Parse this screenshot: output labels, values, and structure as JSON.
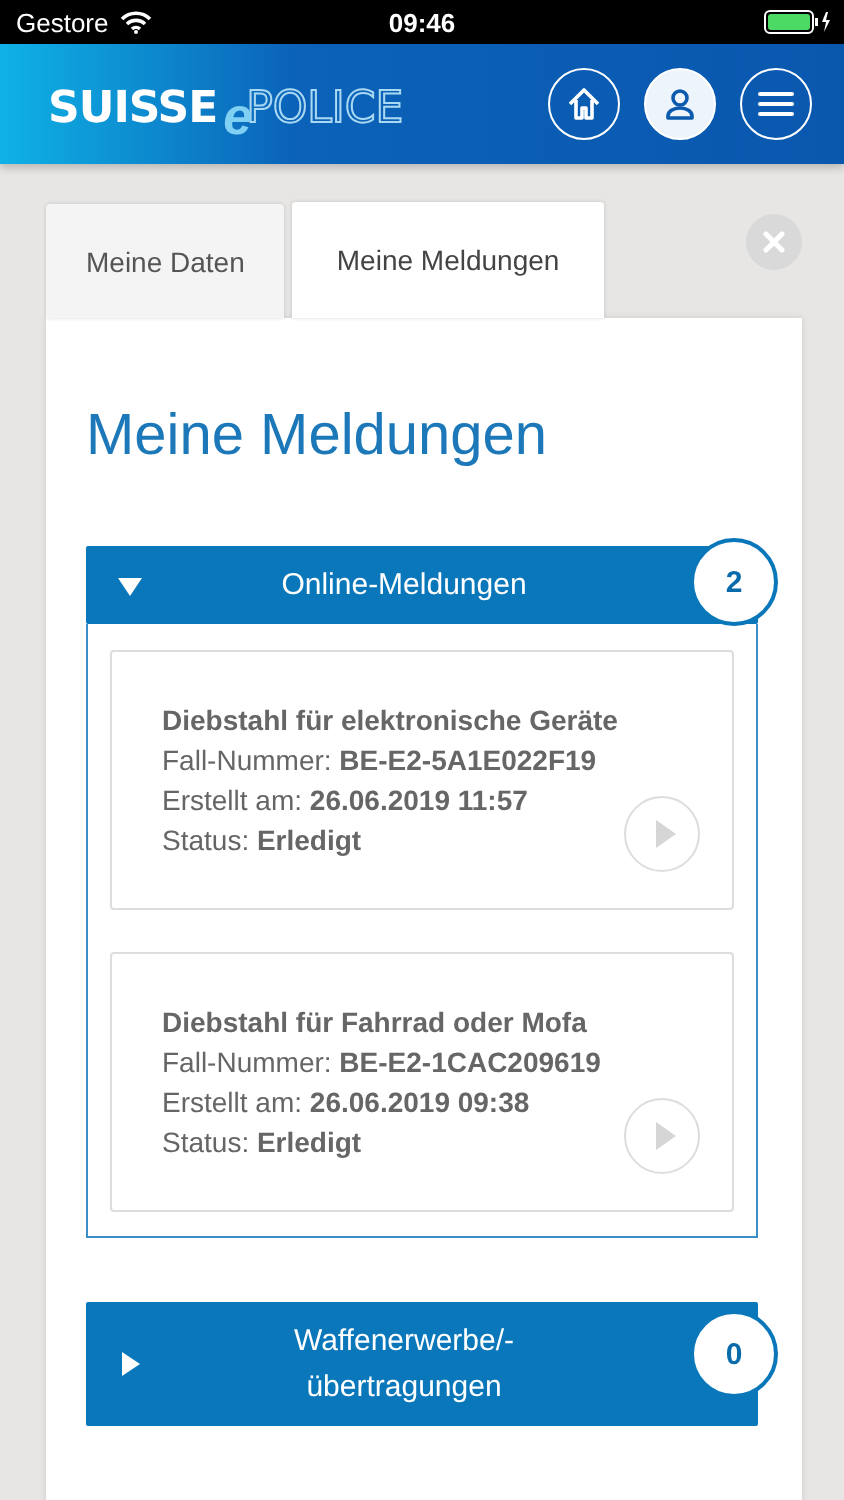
{
  "status_bar": {
    "carrier": "Gestore",
    "time": "09:46"
  },
  "header": {
    "logo": {
      "word": "SUISSE",
      "letter": "e",
      "outline_word": "POLICE"
    }
  },
  "tabs": [
    {
      "label": "Meine Daten",
      "selected": false
    },
    {
      "label": "Meine Meldungen",
      "selected": true
    }
  ],
  "page_title": "Meine Meldungen",
  "sections": [
    {
      "title": "Online-Meldungen",
      "count": "2",
      "expanded": true,
      "items": [
        {
          "title": "Diebstahl für elektronische Geräte",
          "lines": [
            "Fall-Nummer: **BE-E2-5A1E022F19**",
            "Erstellt am: **26.06.2019 11:57**",
            "Status: **Erledigt**"
          ]
        },
        {
          "title": "Diebstahl für Fahrrad oder Mofa",
          "lines": [
            "Fall-Nummer: **BE-E2-1CAC209619**",
            "Erstellt am: **26.06.2019 09:38**",
            "Status: **Erledigt**"
          ]
        }
      ]
    },
    {
      "title": "Waffenerwerbe/-übertragungen",
      "count": "0",
      "expanded": false
    }
  ]
}
